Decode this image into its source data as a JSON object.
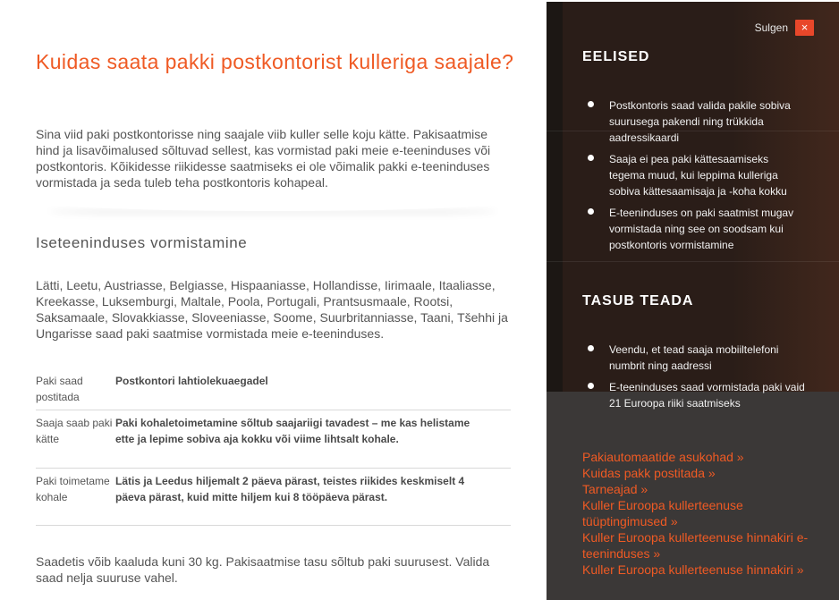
{
  "main": {
    "title": "Kuidas saata pakki postkontorist kulleriga saajale?",
    "intro": "Sina viid paki postkontorisse ning saajale viib kuller selle koju kätte. Pakisaatmise hind ja lisavõimalused sõltuvad sellest, kas vormistad paki meie e-teeninduses või postkontoris. Kõikidesse riikidesse saatmiseks ei ole võimalik pakki e-teeninduses vormistada ja seda tuleb teha postkontoris kohapeal.",
    "section_title": "Iseteeninduses vormistamine",
    "countries": "Lätti, Leetu, Austriasse, Belgiasse, Hispaaniasse, Hollandisse, Iirimaale, Itaaliasse, Kreekasse, Luksemburgi, Maltale, Poola, Portugali, Prantsusmaale, Rootsi, Saksamaale, Slovakkiasse, Sloveeniasse, Soome, Suurbritanniasse, Taani, Tšehhi ja Ungarisse saad paki saatmise vormistada meie e-teeninduses.",
    "table": [
      {
        "label": "Paki saad postitada",
        "value": "Postkontori lahtiolekuaegadel"
      },
      {
        "label": "Saaja saab paki kätte",
        "value": "Paki kohaletoimetamine sõltub saajariigi tavadest – me kas helistame ette ja lepime sobiva aja kokku või viime lihtsalt kohale."
      },
      {
        "label": "Paki toimetame kohale",
        "value": "Lätis ja Leedus hiljemalt 2 päeva pärast, teistes riikides keskmiselt 4 päeva pärast, kuid mitte hiljem kui 8 tööpäeva pärast."
      }
    ],
    "weight_text": "Saadetis võib kaaluda kuni 30 kg. Pakisaatmise tasu sõltub paki suurusest. Valida saad nelja suuruse vahel."
  },
  "side": {
    "close_label": "Sulgen",
    "close_icon": "×",
    "eelised_title": "EELISED",
    "eelised": [
      "Postkontoris saad valida pakile sobiva suurusega pakendi ning trükkida aadressikaardi",
      "Saaja ei pea paki kättesaamiseks tegema muud, kui leppima kulleriga sobiva kättesaamisaja ja -koha kokku",
      "E-teeninduses on paki saatmist mugav vormistada ning see on soodsam kui postkontoris vormistamine"
    ],
    "tasub_title": "TASUB TEADA",
    "tasub": [
      "Veendu, et tead saaja mobiiltelefoni numbrit ning aadressi",
      "E-teeninduses saad vormistada paki vaid 21 Euroopa riiki saatmiseks"
    ],
    "links": [
      "Pakiautomaatide asukohad »",
      "Kuidas pakk postitada »",
      "Tarneajad »",
      "Kuller Euroopa kullerteenuse tüüptingimused »",
      "Kuller Euroopa kullerteenuse hinnakiri e-teeninduses »",
      "Kuller Euroopa kullerteenuse hinnakiri »"
    ]
  },
  "colors": {
    "accent": "#ef5a24",
    "panel_dark": "#2a1d18",
    "panel_grey": "#3b3837",
    "close_button": "#e8472a"
  }
}
